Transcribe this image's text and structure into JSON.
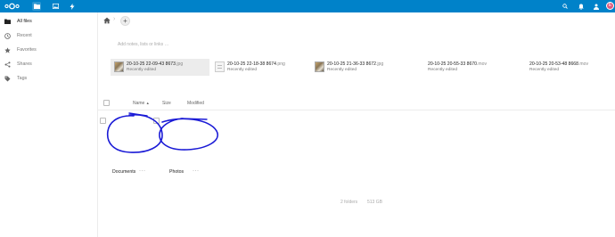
{
  "header": {
    "apps": [
      "files-icon",
      "gallery-icon",
      "activity-icon"
    ],
    "right_icons": [
      "search-icon",
      "notifications-icon",
      "contacts-icon"
    ],
    "avatar_initial": "E",
    "colors": {
      "brand": "#0082c9",
      "avatar": "#e05a7d",
      "annotation": "#1a1ad6"
    }
  },
  "sidebar": {
    "items": [
      {
        "label": "All files",
        "icon": "folder-icon"
      },
      {
        "label": "Recent",
        "icon": "clock-icon"
      },
      {
        "label": "Favorites",
        "icon": "star-icon"
      },
      {
        "label": "Shares",
        "icon": "share-icon"
      },
      {
        "label": "Tags",
        "icon": "tag-icon"
      }
    ]
  },
  "main": {
    "notes_placeholder": "Add notes, lists or links …",
    "recent_files": [
      {
        "name": "20-10-25 22-09-43 8673",
        "ext": ".jpg",
        "status": "Recently edited",
        "thumb": "photo"
      },
      {
        "name": "20-10-25 22-18-38 8674",
        "ext": ".png",
        "status": "Recently edited",
        "thumb": "doc"
      },
      {
        "name": "20-10-25 21-36-33 8672",
        "ext": ".jpg",
        "status": "Recently edited",
        "thumb": "photo"
      },
      {
        "name": "20-10-25 20-55-33 8670",
        "ext": ".mov",
        "status": "Recently edited",
        "thumb": "none"
      },
      {
        "name": "20-10-25 20-53-48 8668",
        "ext": ".mov",
        "status": "Recently edited",
        "thumb": "none"
      }
    ],
    "columns": {
      "name": "Name",
      "size": "Size",
      "modified": "Modified"
    },
    "folders": [
      {
        "name": "Documents",
        "more": "···"
      },
      {
        "name": "Photos",
        "more": "···"
      }
    ],
    "summary": {
      "folders": "2 folders",
      "size": "513 GB"
    }
  }
}
